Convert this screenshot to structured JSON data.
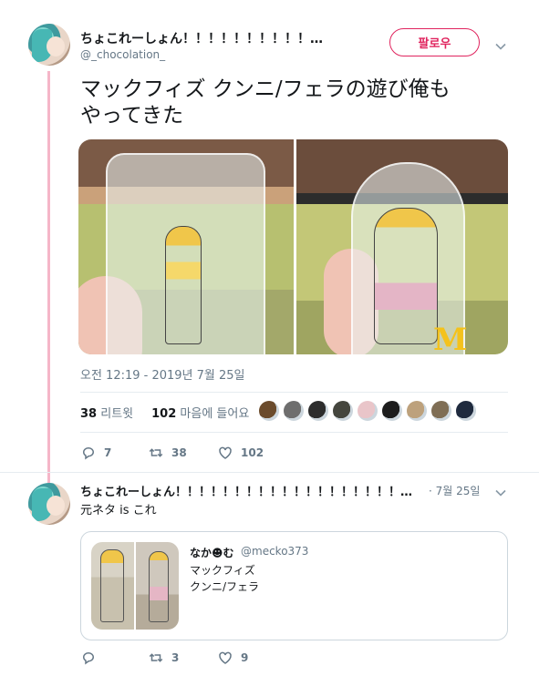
{
  "tweet": {
    "author_name": "ちょこれーしょん！！！！！！！！！！…",
    "author_handle": "@_chocolation_",
    "follow_label": "팔로우",
    "text_line1": "マックフィズ クンニ/フェラの遊び俺も",
    "text_line2": "やってきた",
    "timestamp": "오전 12:19 - 2019년 7월 25일",
    "retweets_count": "38",
    "retweets_label": "리트윗",
    "likes_count": "102",
    "likes_label": "마음에 들어요",
    "liker_colors": [
      "#6b4b2c",
      "#6e6e6e",
      "#2d2d2d",
      "#45463e",
      "#e9c5c9",
      "#1d1d1d",
      "#bda17c",
      "#7f6e55",
      "#1f2a3e"
    ],
    "actions": {
      "replies": "7",
      "retweets": "38",
      "likes": "102"
    }
  },
  "reply": {
    "author_name": "ちょこれーしょん！！！！！！！！！！！！！！！！！！！…",
    "date": "· 7월 25일",
    "text": "元ネタ is これ",
    "quote": {
      "author_name": "なか☻む",
      "author_handle": "@mecko373",
      "line1": "マックフィズ",
      "line2": "クンニ/フェラ"
    },
    "actions": {
      "replies": "",
      "retweets": "3",
      "likes": "9"
    }
  },
  "image_text": {
    "logo": "M"
  },
  "colors": {
    "accent": "#e0245e",
    "thread": "#f5b6c8",
    "secondary": "#657786"
  }
}
